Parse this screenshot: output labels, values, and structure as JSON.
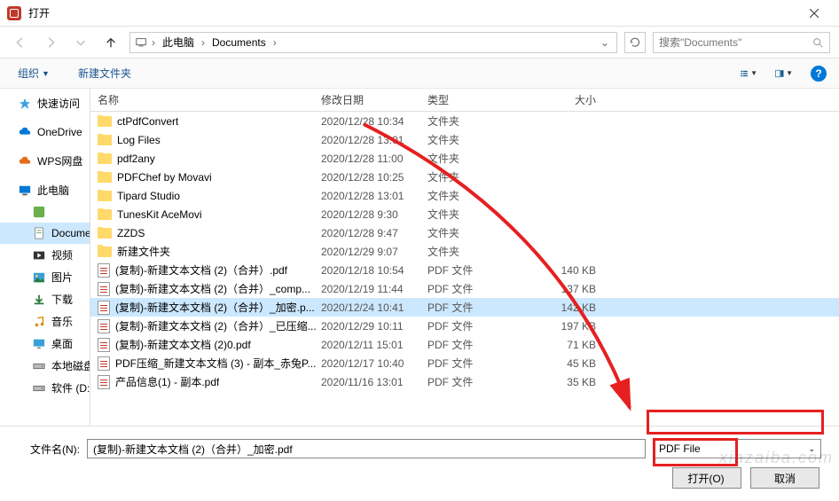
{
  "window": {
    "title": "打开"
  },
  "nav": {
    "breadcrumb": {
      "root": "此电脑",
      "folder": "Documents"
    },
    "search_placeholder": "搜索\"Documents\""
  },
  "toolbar": {
    "organize": "组织",
    "new_folder": "新建文件夹"
  },
  "sidebar": {
    "items": [
      {
        "label": "快速访问",
        "icon": "star",
        "color": "#3ca0e6"
      },
      {
        "label": "OneDrive",
        "icon": "cloud",
        "color": "#0078d7"
      },
      {
        "label": "WPS网盘",
        "icon": "cloud",
        "color": "#e66b1a"
      },
      {
        "label": "此电脑",
        "icon": "monitor",
        "color": "#0078d7"
      }
    ],
    "subs": [
      {
        "label": "Docume",
        "icon": "doc",
        "selected": true
      },
      {
        "label": "视频",
        "icon": "video"
      },
      {
        "label": "图片",
        "icon": "image"
      },
      {
        "label": "下载",
        "icon": "download"
      },
      {
        "label": "音乐",
        "icon": "music"
      },
      {
        "label": "桌面",
        "icon": "desktop"
      },
      {
        "label": "本地磁盘",
        "icon": "drive"
      },
      {
        "label": "软件 (D:",
        "icon": "drive"
      }
    ]
  },
  "columns": {
    "name": "名称",
    "date": "修改日期",
    "type": "类型",
    "size": "大小"
  },
  "files": [
    {
      "name": "ctPdfConvert",
      "date": "2020/12/28 10:34",
      "type": "文件夹",
      "size": "",
      "kind": "folder"
    },
    {
      "name": "Log Files",
      "date": "2020/12/28 13:01",
      "type": "文件夹",
      "size": "",
      "kind": "folder"
    },
    {
      "name": "pdf2any",
      "date": "2020/12/28 11:00",
      "type": "文件夹",
      "size": "",
      "kind": "folder"
    },
    {
      "name": "PDFChef by Movavi",
      "date": "2020/12/28 10:25",
      "type": "文件夹",
      "size": "",
      "kind": "folder"
    },
    {
      "name": "Tipard Studio",
      "date": "2020/12/28 13:01",
      "type": "文件夹",
      "size": "",
      "kind": "folder"
    },
    {
      "name": "TunesKit AceMovi",
      "date": "2020/12/28 9:30",
      "type": "文件夹",
      "size": "",
      "kind": "folder"
    },
    {
      "name": "ZZDS",
      "date": "2020/12/28 9:47",
      "type": "文件夹",
      "size": "",
      "kind": "folder"
    },
    {
      "name": "新建文件夹",
      "date": "2020/12/29 9:07",
      "type": "文件夹",
      "size": "",
      "kind": "folder"
    },
    {
      "name": "(复制)-新建文本文档 (2)（合并）.pdf",
      "date": "2020/12/18 10:54",
      "type": "PDF 文件",
      "size": "140 KB",
      "kind": "pdf"
    },
    {
      "name": "(复制)-新建文本文档 (2)（合并）_comp...",
      "date": "2020/12/19 11:44",
      "type": "PDF 文件",
      "size": "137 KB",
      "kind": "pdf"
    },
    {
      "name": "(复制)-新建文本文档 (2)（合并）_加密.p...",
      "date": "2020/12/24 10:41",
      "type": "PDF 文件",
      "size": "142 KB",
      "kind": "pdf",
      "selected": true
    },
    {
      "name": "(复制)-新建文本文档 (2)（合并）_已压缩...",
      "date": "2020/12/29 10:11",
      "type": "PDF 文件",
      "size": "197 KB",
      "kind": "pdf"
    },
    {
      "name": "(复制)-新建文本文档 (2)0.pdf",
      "date": "2020/12/11 15:01",
      "type": "PDF 文件",
      "size": "71 KB",
      "kind": "pdf"
    },
    {
      "name": "PDF压缩_新建文本文档 (3) - 副本_赤兔P...",
      "date": "2020/12/17 10:40",
      "type": "PDF 文件",
      "size": "45 KB",
      "kind": "pdf"
    },
    {
      "name": "产品信息(1) - 副本.pdf",
      "date": "2020/11/16 13:01",
      "type": "PDF 文件",
      "size": "35 KB",
      "kind": "pdf"
    }
  ],
  "footer": {
    "filename_label": "文件名(N):",
    "filename_value": "(复制)-新建文本文档 (2)（合并）_加密.pdf",
    "filetype": "PDF File",
    "open": "打开(O)",
    "cancel": "取消"
  },
  "watermark": "xiazaiba.com"
}
